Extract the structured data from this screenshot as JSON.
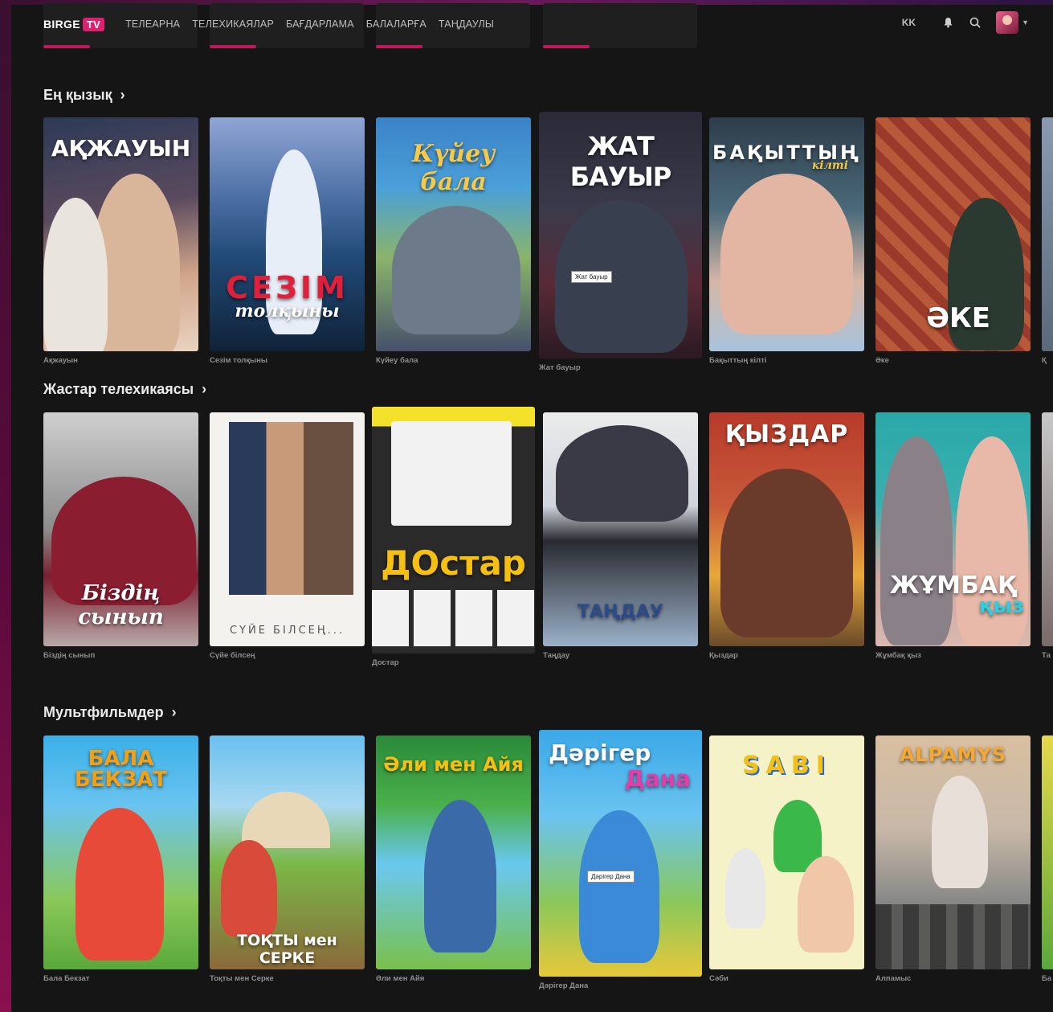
{
  "brand": {
    "name": "BIRGE",
    "badge": "TV"
  },
  "nav": [
    "ТЕЛЕАРНА",
    "ТЕЛЕХИКАЯЛАР",
    "БАҒДАРЛАМА",
    "БАЛАЛАРҒА",
    "ТАҢДАУЛЫ"
  ],
  "header": {
    "lang": "KK"
  },
  "colors": {
    "accent": "#e0206e",
    "background": "#151515"
  },
  "sections": [
    {
      "title": "Ең қызық",
      "items": [
        {
          "caption": "Ақжауын",
          "poster_title": "АҚЖАУЫН"
        },
        {
          "caption": "Сезім толқыны",
          "poster_title": "СЕЗІМ",
          "poster_sub": "толқыны"
        },
        {
          "caption": "Күйеу бала",
          "poster_title": "Күйеу бала"
        },
        {
          "caption": "Жат бауыр",
          "poster_title": "ЖАТ БАУЫР",
          "tooltip": "Жат бауыр"
        },
        {
          "caption": "Бақыттың кілті",
          "poster_title": "БАҚЫТТЫҢ",
          "poster_sub": "кілті"
        },
        {
          "caption": "Әке",
          "poster_title": "ӘКЕ"
        }
      ],
      "peek_caption": "Қ"
    },
    {
      "title": "Жастар телехикаясы",
      "items": [
        {
          "caption": "Біздің сынып",
          "poster_title": "Біздің сынып"
        },
        {
          "caption": "Сүйе білсең",
          "poster_title": "СҮЙЕ БІЛСЕҢ..."
        },
        {
          "caption": "Достар",
          "poster_title": "ДОстар"
        },
        {
          "caption": "Таңдау",
          "poster_title": "ТАҢДАУ"
        },
        {
          "caption": "Қыздар",
          "poster_title": "ҚЫЗДАР"
        },
        {
          "caption": "Жұмбақ қыз",
          "poster_title": "ЖҰМБАҚ",
          "poster_sub": "қыз"
        }
      ],
      "peek_caption": "Та"
    },
    {
      "title": "Мультфильмдер",
      "items": [
        {
          "caption": "Бала Бекзат",
          "poster_title": "БАЛА БЕКЗАТ"
        },
        {
          "caption": "Тоқты мен Серке",
          "poster_title": "ТОҚТЫ мен СЕРКЕ"
        },
        {
          "caption": "Әли мен Айя",
          "poster_title": "Әли мен Айя"
        },
        {
          "caption": "Дәрігер Дана",
          "poster_title": "Дәрігер",
          "poster_sub": "Дана",
          "tooltip": "Дәрігер Дана"
        },
        {
          "caption": "Сәби",
          "poster_title": "SABI"
        },
        {
          "caption": "Алпамыс",
          "poster_title": "ALPAMYS"
        }
      ],
      "peek_caption": "Ба"
    }
  ]
}
